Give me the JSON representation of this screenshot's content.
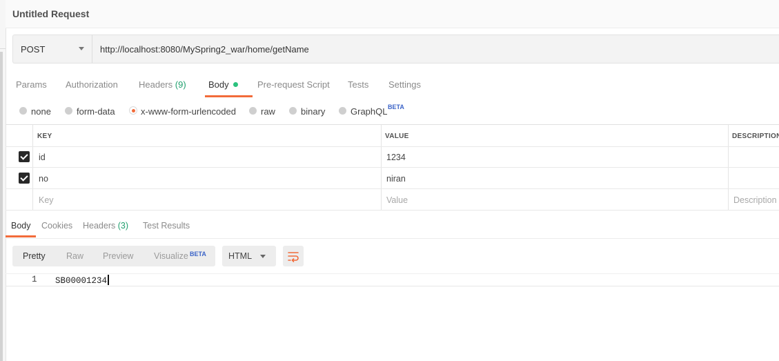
{
  "window": {
    "title": "Untitled Request"
  },
  "request": {
    "method": "POST",
    "url": "http://localhost:8080/MySpring2_war/home/getName"
  },
  "request_tabs": [
    {
      "label": "Params"
    },
    {
      "label": "Authorization"
    },
    {
      "label": "Headers",
      "count": "(9)"
    },
    {
      "label": "Body",
      "active": true
    },
    {
      "label": "Pre-request Script"
    },
    {
      "label": "Tests"
    },
    {
      "label": "Settings"
    }
  ],
  "body_types": [
    {
      "label": "none"
    },
    {
      "label": "form-data"
    },
    {
      "label": "x-www-form-urlencoded",
      "selected": true
    },
    {
      "label": "raw"
    },
    {
      "label": "binary"
    },
    {
      "label": "GraphQL",
      "badge": "BETA"
    }
  ],
  "params_table": {
    "headers": [
      "KEY",
      "VALUE",
      "DESCRIPTION"
    ],
    "rows": [
      {
        "checked": true,
        "key": "id",
        "value": "1234"
      },
      {
        "checked": true,
        "key": "no",
        "value": "niran"
      }
    ],
    "placeholders": {
      "key": "Key",
      "value": "Value",
      "description": "Description"
    }
  },
  "response_tabs": [
    {
      "label": "Body",
      "active": true
    },
    {
      "label": "Cookies"
    },
    {
      "label": "Headers",
      "count": "(3)"
    },
    {
      "label": "Test Results"
    }
  ],
  "response_toolbar": {
    "formats": [
      {
        "label": "Pretty",
        "active": true
      },
      {
        "label": "Raw"
      },
      {
        "label": "Preview"
      },
      {
        "label": "Visualize",
        "badge": "BETA"
      }
    ],
    "language": "HTML",
    "wrap_icon": "wrap-lines-icon"
  },
  "response_body": {
    "lines": [
      {
        "number": "1",
        "text": "SB00001234"
      }
    ]
  },
  "colors": {
    "accent": "#f26b3a",
    "count_green": "#20a06e",
    "dot_green": "#2cc27e",
    "beta_blue": "#3c64c8"
  }
}
